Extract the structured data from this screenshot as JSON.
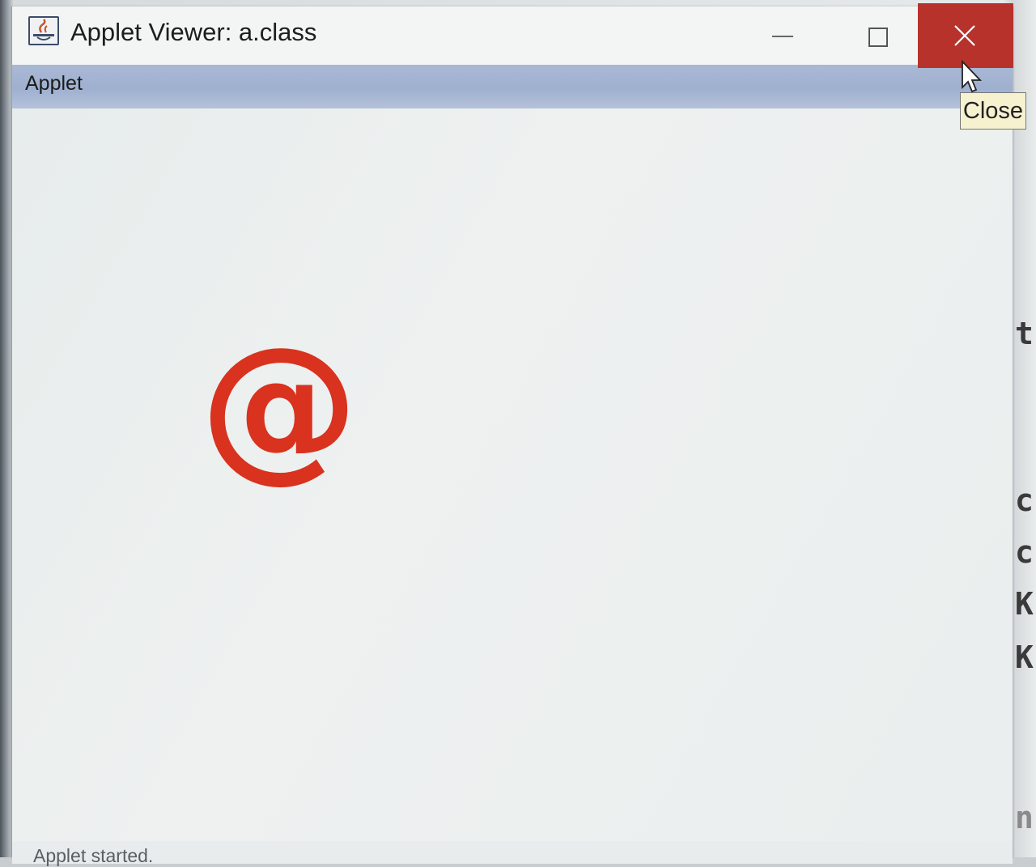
{
  "window": {
    "title": "Applet Viewer: a.class"
  },
  "menubar": {
    "menu_label": "Applet"
  },
  "canvas": {
    "glyph": "@",
    "glyph_color": "#d9321e"
  },
  "status": {
    "text": "Applet started."
  },
  "tooltip": {
    "text": "Close"
  },
  "background_window": {
    "edge_chars": [
      "t",
      "c",
      "c",
      "K",
      "K",
      "n"
    ]
  },
  "colors": {
    "close_button": "#b8322c",
    "menubar": "#a9b8d4",
    "tooltip_bg": "#f6f1cf"
  }
}
